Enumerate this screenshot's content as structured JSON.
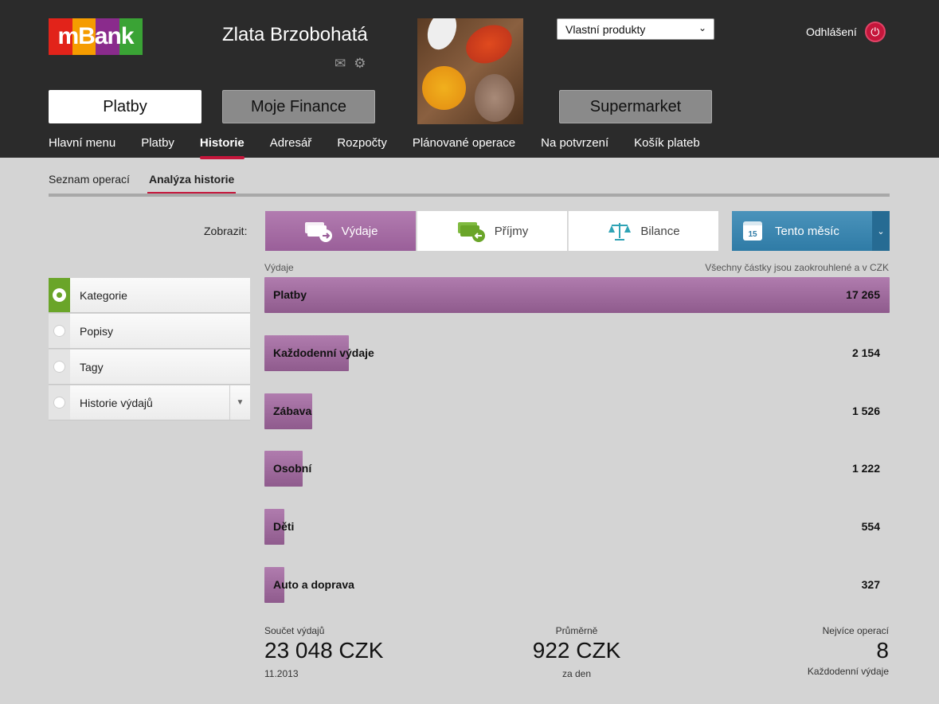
{
  "brand": {
    "logo_text": "mBank",
    "stripe_colors": [
      "#e2231a",
      "#f59c00",
      "#8a2b8c",
      "#3aa335"
    ]
  },
  "user": {
    "name": "Zlata Brzobohatá",
    "icons": [
      "mail-icon",
      "gear-icon"
    ]
  },
  "header": {
    "product_select": "Vlastní produkty",
    "logout_label": "Odhlášení",
    "big_tabs": [
      "Platby",
      "Moje Finance",
      "Supermarket"
    ]
  },
  "nav": {
    "items": [
      "Hlavní menu",
      "Platby",
      "Historie",
      "Adresář",
      "Rozpočty",
      "Plánované operace",
      "Na potvrzení",
      "Košík plateb"
    ],
    "active": "Historie"
  },
  "subtabs": {
    "items": [
      "Seznam operací",
      "Analýza historie"
    ],
    "active": "Analýza historie"
  },
  "filter": {
    "label": "Zobrazit:",
    "buttons": [
      "Výdaje",
      "Příjmy",
      "Bilance"
    ],
    "active": "Výdaje",
    "period": "Tento měsíc",
    "calendar_day": "15"
  },
  "options": {
    "items": [
      "Kategorie",
      "Popisy",
      "Tagy",
      "Historie výdajů"
    ],
    "selected": "Kategorie"
  },
  "chart_header": {
    "left": "Výdaje",
    "right": "Všechny částky jsou zaokrouhlené a v CZK"
  },
  "chart_data": {
    "type": "bar",
    "orientation": "horizontal",
    "categories": [
      "Platby",
      "Každodenní výdaje",
      "Zábava",
      "Osobní",
      "Děti",
      "Auto a doprava"
    ],
    "values": [
      17265,
      2154,
      1526,
      1222,
      554,
      327
    ],
    "value_labels": [
      "17 265",
      "2 154",
      "1 526",
      "1 222",
      "554",
      "327"
    ],
    "color": "#9f6a9d"
  },
  "stats": {
    "sum_label": "Součet výdajů",
    "sum_value": "23 048 CZK",
    "sum_period": "11.2013",
    "avg_label": "Průměrně",
    "avg_value": "922 CZK",
    "avg_unit": "za den",
    "most_label": "Nejvíce operací",
    "most_value": "8",
    "most_category": "Každodenní výdaje"
  }
}
